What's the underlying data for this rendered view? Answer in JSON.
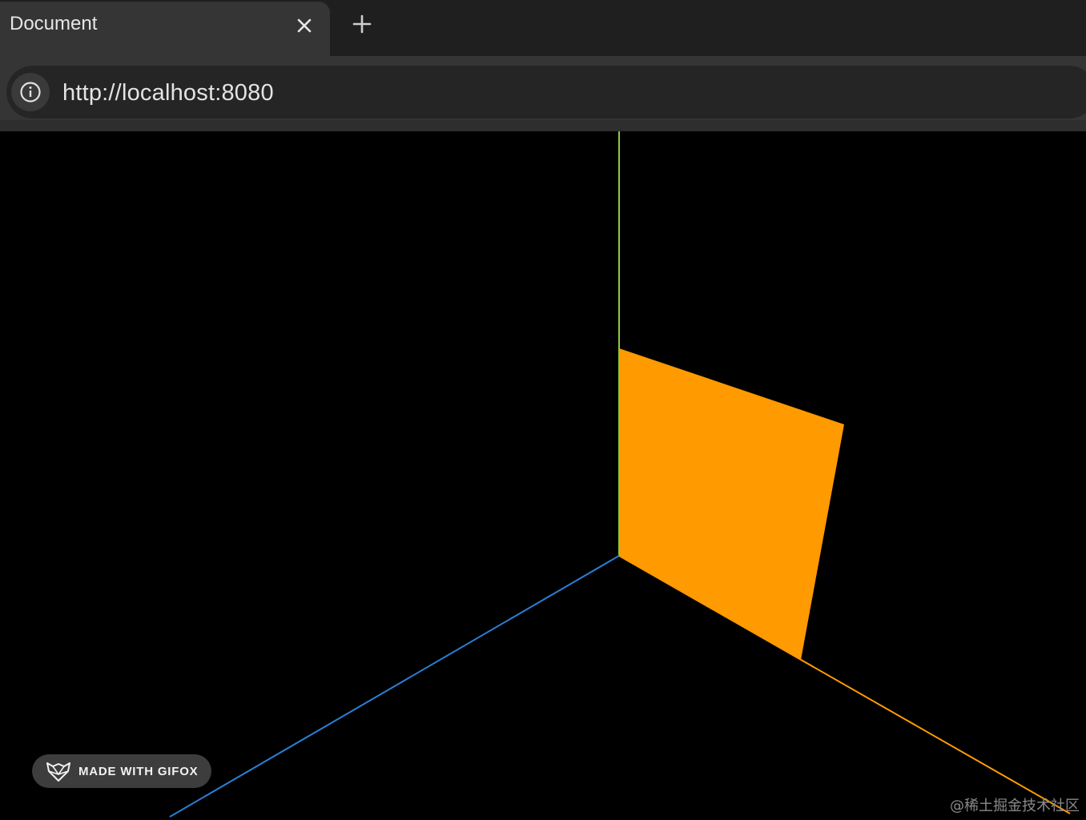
{
  "tab": {
    "title": "Document",
    "close_icon": "close-icon"
  },
  "new_tab_icon": "plus-icon",
  "address_bar": {
    "url": "http://localhost:8080",
    "site_info_icon": "info-icon"
  },
  "scene": {
    "background_color": "#000000",
    "y_axis_color": "#8fcc3a",
    "x_axis_color": "#ff9a00",
    "z_axis_color": "#2a7fd4",
    "plane_color": "#ff9a00"
  },
  "badge": {
    "text": "MADE WITH GIFOX",
    "icon": "fox-logo-icon"
  },
  "watermark": "@稀土掘金技术社区"
}
